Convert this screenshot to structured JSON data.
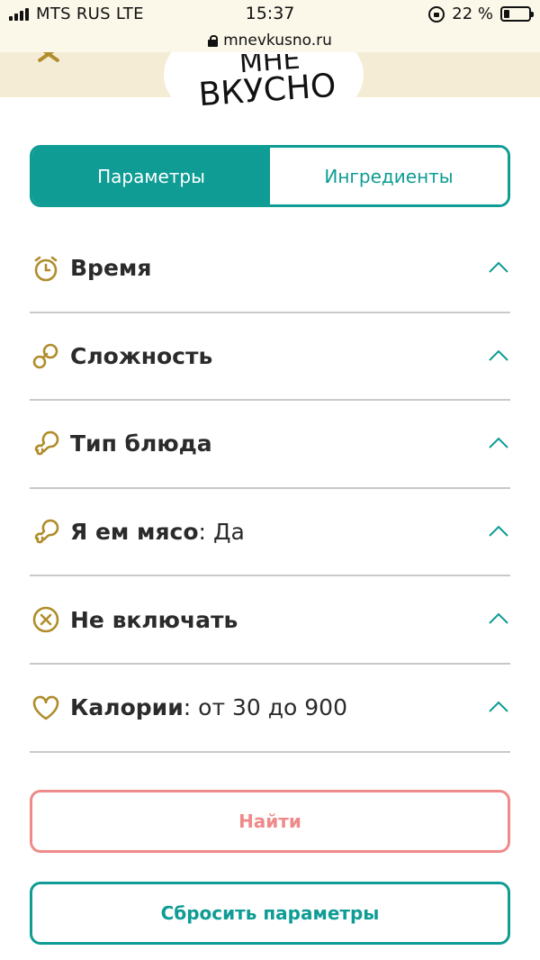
{
  "status_bar": {
    "carrier": "MTS RUS",
    "network": "LTE",
    "time": "15:37",
    "battery_percent": "22 %",
    "battery_level": 0.22
  },
  "url_bar": {
    "url": "mnevkusno.ru"
  },
  "header": {
    "logo_line1": "МНЕ",
    "logo_line2": "ВКУСНО"
  },
  "tabs": [
    {
      "label": "Параметры",
      "active": true
    },
    {
      "label": "Ингредиенты",
      "active": false
    }
  ],
  "filters": [
    {
      "icon": "alarm-clock-icon",
      "label": "Время",
      "value": ""
    },
    {
      "icon": "pacifier-icon",
      "label": "Сложность",
      "value": ""
    },
    {
      "icon": "drumstick-icon",
      "label": "Тип блюда",
      "value": ""
    },
    {
      "icon": "drumstick-icon",
      "label": "Я ем мясо",
      "value": "Да"
    },
    {
      "icon": "circle-x-icon",
      "label": "Не включать",
      "value": ""
    },
    {
      "icon": "heart-icon",
      "label": "Калории",
      "value": "от 30 до 900"
    }
  ],
  "buttons": {
    "find": "Найти",
    "reset": "Сбросить параметры"
  },
  "colors": {
    "accent": "#0e9c94",
    "find": "#ef8a8a",
    "icon_gold": "#b08c2a",
    "header_bg": "#f4ecd5"
  }
}
